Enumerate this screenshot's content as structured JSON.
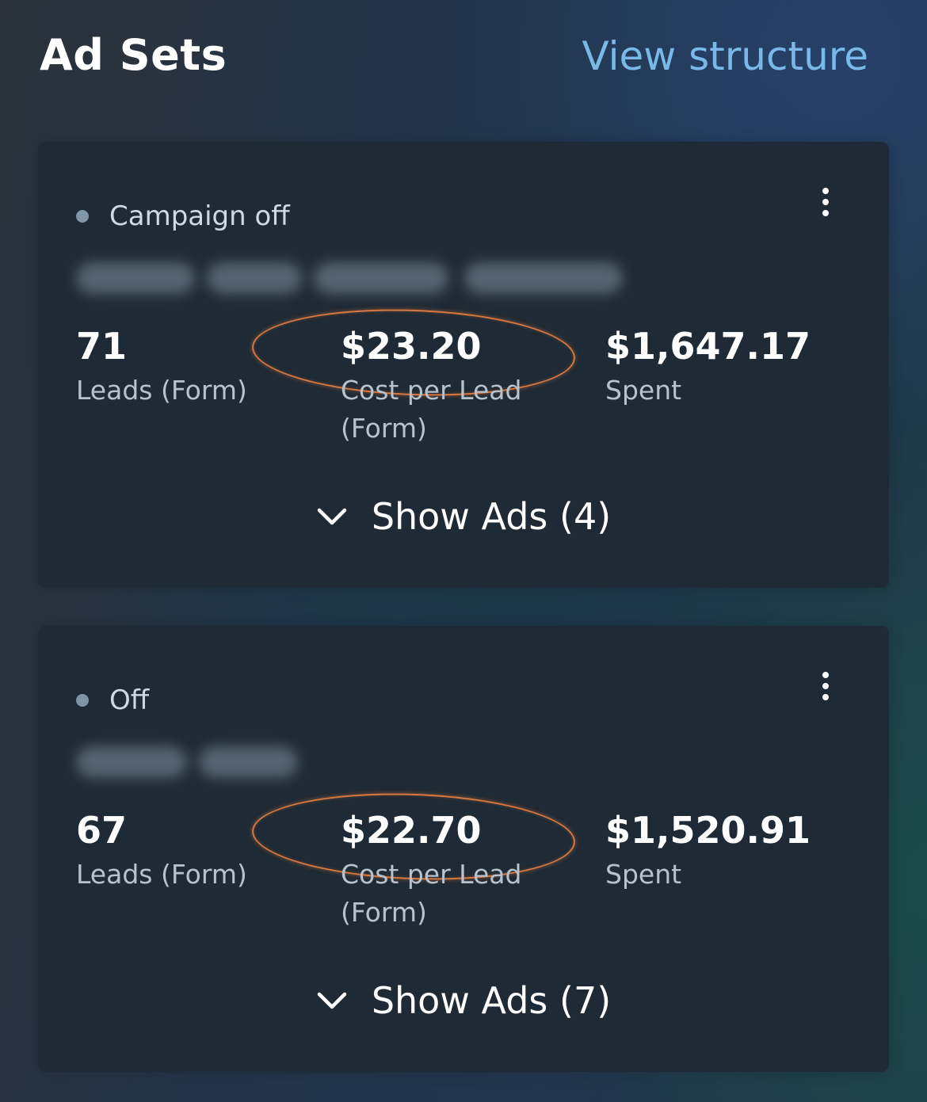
{
  "header": {
    "title": "Ad Sets",
    "link_label": "View structure"
  },
  "ad_sets": [
    {
      "status": "Campaign off",
      "leads_value": "71",
      "leads_label": "Leads (Form)",
      "cpl_value": "$23.20",
      "cpl_label": "Cost per Lead (Form)",
      "spent_value": "$1,647.17",
      "spent_label": "Spent",
      "show_ads_label": "Show Ads (4)"
    },
    {
      "status": "Off",
      "leads_value": "67",
      "leads_label": "Leads (Form)",
      "cpl_value": "$22.70",
      "cpl_label": "Cost per Lead (Form)",
      "spent_value": "$1,520.91",
      "spent_label": "Spent",
      "show_ads_label": "Show Ads (7)"
    }
  ],
  "icons": {
    "status": "status-dot-icon",
    "more": "more-vertical-icon",
    "expand": "chevron-down-icon"
  },
  "colors": {
    "link": "#7ab8e8",
    "card_bg": "#1e2a35",
    "status_dot": "#7f95a8",
    "highlight": "#d9793f"
  }
}
